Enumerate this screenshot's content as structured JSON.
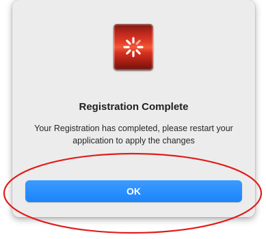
{
  "dialog": {
    "icon": "spinner-app-icon",
    "title": "Registration Complete",
    "message": "Your Registration has completed, please restart your application to apply the changes",
    "ok_label": "OK"
  },
  "colors": {
    "button": "#1c84fb",
    "annotation": "#e21b1b",
    "icon_red": "#d8301f"
  }
}
